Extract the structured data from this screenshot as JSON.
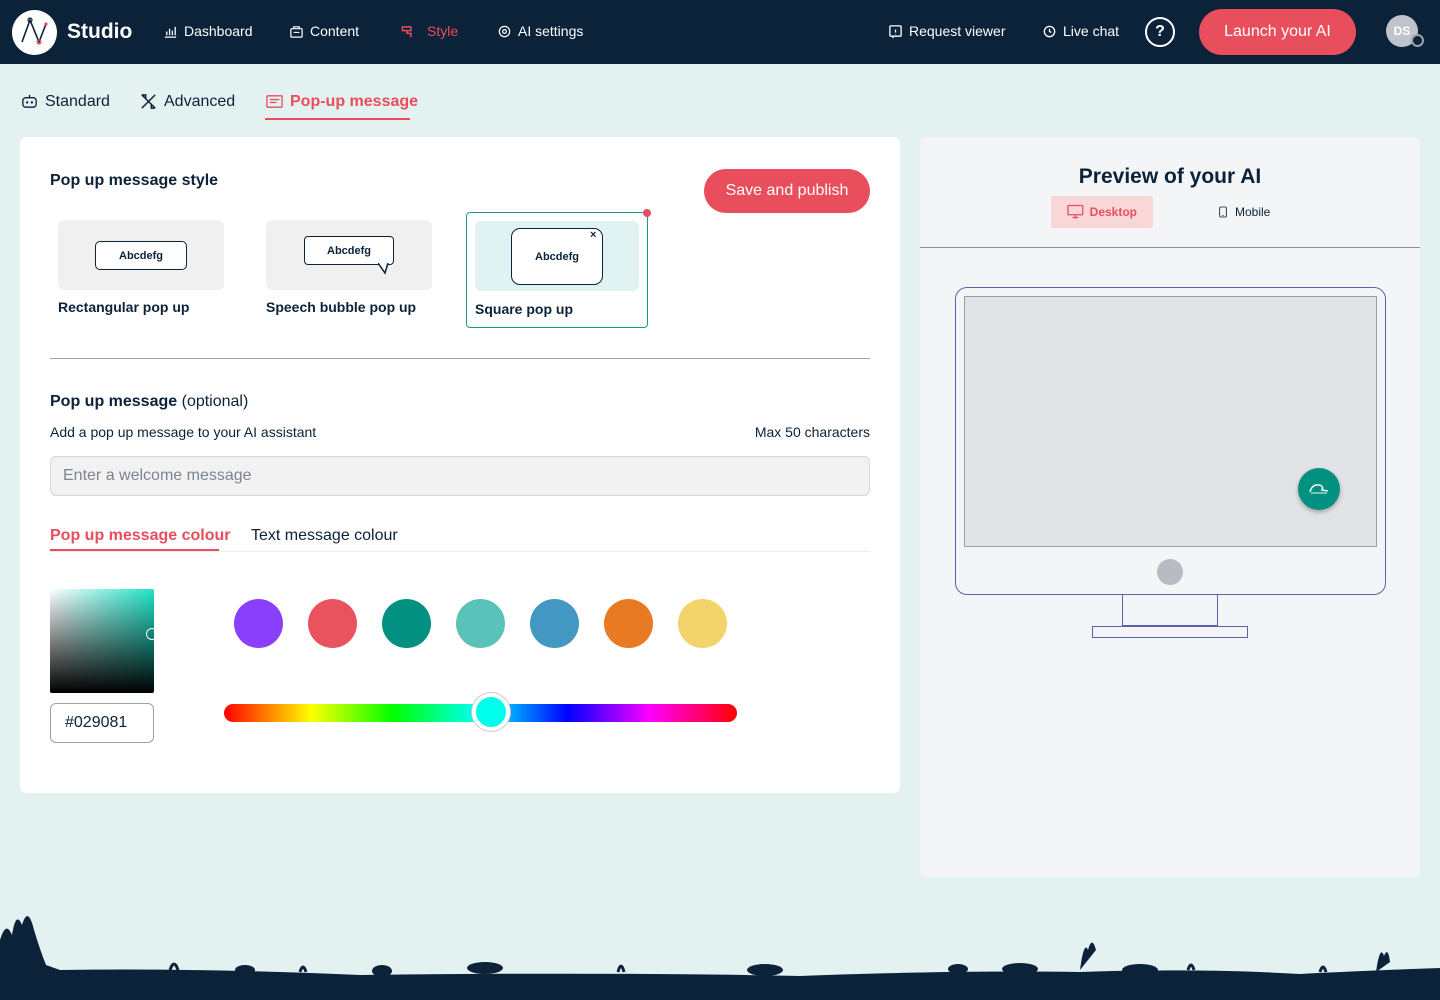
{
  "app": {
    "brand": "Studio"
  },
  "nav": {
    "items": [
      {
        "label": "Dashboard",
        "icon": "chart-icon"
      },
      {
        "label": "Content",
        "icon": "content-icon"
      },
      {
        "label": "Style",
        "icon": "paint-icon",
        "active": true
      },
      {
        "label": "AI settings",
        "icon": "ai-settings-icon"
      }
    ],
    "request_viewer": "Request viewer",
    "live_chat": "Live chat",
    "help": "?",
    "launch": "Launch your AI",
    "avatar_initials": "DS"
  },
  "subtabs": [
    {
      "label": "Standard",
      "icon": "robot-icon"
    },
    {
      "label": "Advanced",
      "icon": "tools-icon"
    },
    {
      "label": "Pop-up message",
      "icon": "message-icon",
      "active": true
    }
  ],
  "editor": {
    "style_title": "Pop up message style",
    "save_label": "Save and publish",
    "styles": [
      {
        "label": "Rectangular pop up",
        "sample": "Abcdefg"
      },
      {
        "label": "Speech bubble pop up",
        "sample": "Abcdefg"
      },
      {
        "label": "Square pop up",
        "sample": "Abcdefg",
        "close": "×",
        "selected": true
      }
    ],
    "message_title": "Pop up message",
    "message_optional": "(optional)",
    "message_subtitle": "Add a pop up message to your AI assistant",
    "max_chars": "Max 50 characters",
    "message_value": "",
    "message_placeholder": "Enter a welcome message",
    "colour_tabs": [
      {
        "label": "Pop up message colour",
        "active": true
      },
      {
        "label": "Text message colour"
      }
    ],
    "hex_value": "#029081",
    "swatches": [
      "#8a3ffc",
      "#e8535d",
      "#029081",
      "#5bc2ba",
      "#4298c2",
      "#e87a24",
      "#f2d46b"
    ],
    "hue_position": 0.52
  },
  "preview": {
    "title": "Preview of your AI",
    "tabs": [
      {
        "label": "Desktop",
        "icon": "desktop-icon",
        "active": true
      },
      {
        "label": "Mobile",
        "icon": "mobile-icon"
      }
    ],
    "launcher_color": "#029081"
  },
  "colors": {
    "navy": "#0b2239",
    "accent": "#e84e5b",
    "teal": "#029081",
    "page_bg": "#e4f1f1"
  }
}
